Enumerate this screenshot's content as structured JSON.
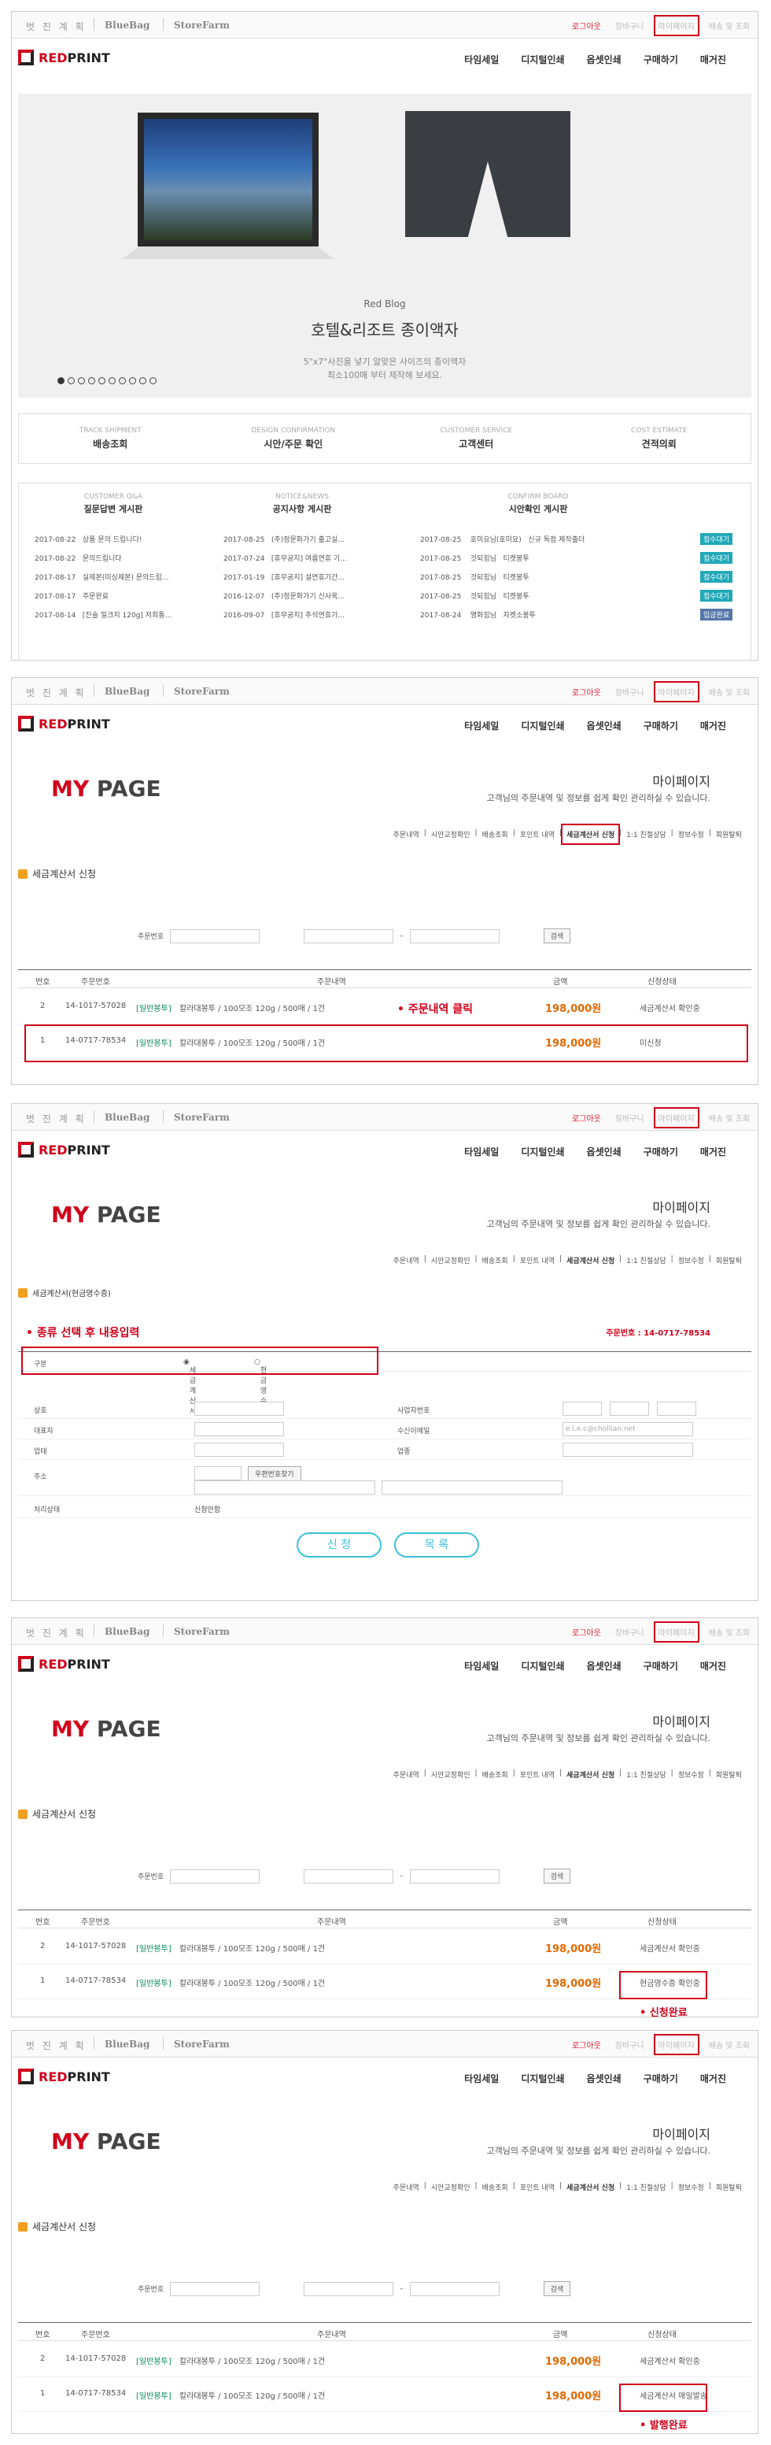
{
  "topbar": {
    "brand1": "벗 진 계 획",
    "brand2": "BlueBag",
    "brand3": "StoreFarm",
    "utils": [
      "로그아웃",
      "장바구니",
      "마이페이지",
      "배송 및 조회"
    ]
  },
  "logo": {
    "red": "RED",
    "dark": "PRINT"
  },
  "gnb": [
    "타임세일",
    "디지털인쇄",
    "옵셋인쇄",
    "구매하기",
    "매거진"
  ],
  "hero": {
    "tag": "Red Blog",
    "title": "호텔&리조트 종이액자",
    "desc1": "5\"x7\"사진을 넣기 알맞은 사이즈의 종이액자",
    "desc2": "최소100매 부터 제작해 보세요.",
    "dot_count": 10,
    "active_dot": 0
  },
  "quick": [
    {
      "en": "TRACK SHIPMENT",
      "ko": "배송조회"
    },
    {
      "en": "DESIGN CONFIRMATION",
      "ko": "시안/주문 확인"
    },
    {
      "en": "CUSTOMER SERVICE",
      "ko": "고객센터"
    },
    {
      "en": "COST ESTIMATE",
      "ko": "견적의뢰"
    }
  ],
  "boards": {
    "qna": {
      "en": "CUSTOMER Q&A",
      "ko": "질문답변 게시판",
      "rows": [
        [
          "2017-08-22",
          "상품 문의 드립니다!"
        ],
        [
          "2017-08-22",
          "문의드립니다"
        ],
        [
          "2017-08-17",
          "실제본(미싱제본) 문의드립..."
        ],
        [
          "2017-08-17",
          "주문완료"
        ],
        [
          "2017-08-14",
          "[진솔 밀크지 120g] 저희통..."
        ]
      ]
    },
    "notice": {
      "en": "NOTICE&NEWS",
      "ko": "공지사항 게시판",
      "rows": [
        [
          "2017-08-25",
          "(주)정문화가기 출고실..."
        ],
        [
          "2017-07-24",
          "[휴무공지] 여름연휴 기..."
        ],
        [
          "2017-01-19",
          "[휴무공지] 설연휴기간..."
        ],
        [
          "2016-12-07",
          "(주)정문화가기 신사옥..."
        ],
        [
          "2016-09-07",
          "[휴무공지] 추석연휴기..."
        ]
      ]
    },
    "confirm": {
      "en": "CONFIRM BOARD",
      "ko": "시안확인 게시판",
      "rows": [
        [
          "2017-08-25",
          "호미요님(호미요)",
          "신규 독점 제작출더",
          "접수대기"
        ],
        [
          "2017-08-25",
          "것되힘님",
          "티켓봉투",
          "접수대기"
        ],
        [
          "2017-08-25",
          "것되힘님",
          "티켓봉투",
          "접수대기"
        ],
        [
          "2017-08-25",
          "것되힘님",
          "티켓봉투",
          "접수대기"
        ],
        [
          "2017-08-24",
          "명화힘님",
          "자켓소봉투",
          "입금완료"
        ]
      ]
    }
  },
  "mypage": {
    "title_red": "MY",
    "title_dark": "PAGE",
    "ko": "마이페이지",
    "desc": "고객님의 주문내역 및 정보를 쉽게 확인 관리하실 수 있습니다.",
    "tabs": [
      "주문내역",
      "시안교정확인",
      "배송조회",
      "포인트 내역",
      "세금계산서 신청",
      "1:1 친절상담",
      "정보수정",
      "회원탈퇴"
    ]
  },
  "tax": {
    "section": "세금계산서 신청",
    "order_label": "주문번호",
    "search_btn": "검색",
    "headers": [
      "번호",
      "주문번호",
      "주문내역",
      "금액",
      "신청상태"
    ],
    "type": "[일반봉투]",
    "item": "칼라대봉투 / 100모조 120g / 500매 / 1건",
    "amount": "198,000원",
    "row1": {
      "no": "2",
      "order": "14-1017-57028",
      "status": "세금계산서 확인중"
    },
    "row2": {
      "no": "1",
      "order": "14-0717-78534"
    }
  },
  "p2": {
    "note": "• 주문내역 클릭",
    "status": "미신청"
  },
  "p3": {
    "section": "세금계산서(현금영수증)",
    "note": "• 종류 선택 후 내용입력",
    "order_no": "주문번호 : 14-0717-78534",
    "kind_label": "구분",
    "opt1": "세금계산서",
    "opt2": "현금영수증",
    "fields_l": [
      "상호",
      "대표자",
      "업태",
      "주소",
      "처리상태"
    ],
    "fields_r": [
      "사업자번호",
      "수신이메일",
      "업종"
    ],
    "email_ph": "e.l.e.c@chollian.net",
    "zip_btn": "우편번호찾기",
    "state": "신청안함",
    "btn_apply": "신 청",
    "btn_list": "목 록"
  },
  "p4": {
    "status": "현금영수증 확인중",
    "note": "• 신청완료"
  },
  "p5": {
    "status": "세금계산서 매일발송",
    "note": "• 발행완료"
  }
}
